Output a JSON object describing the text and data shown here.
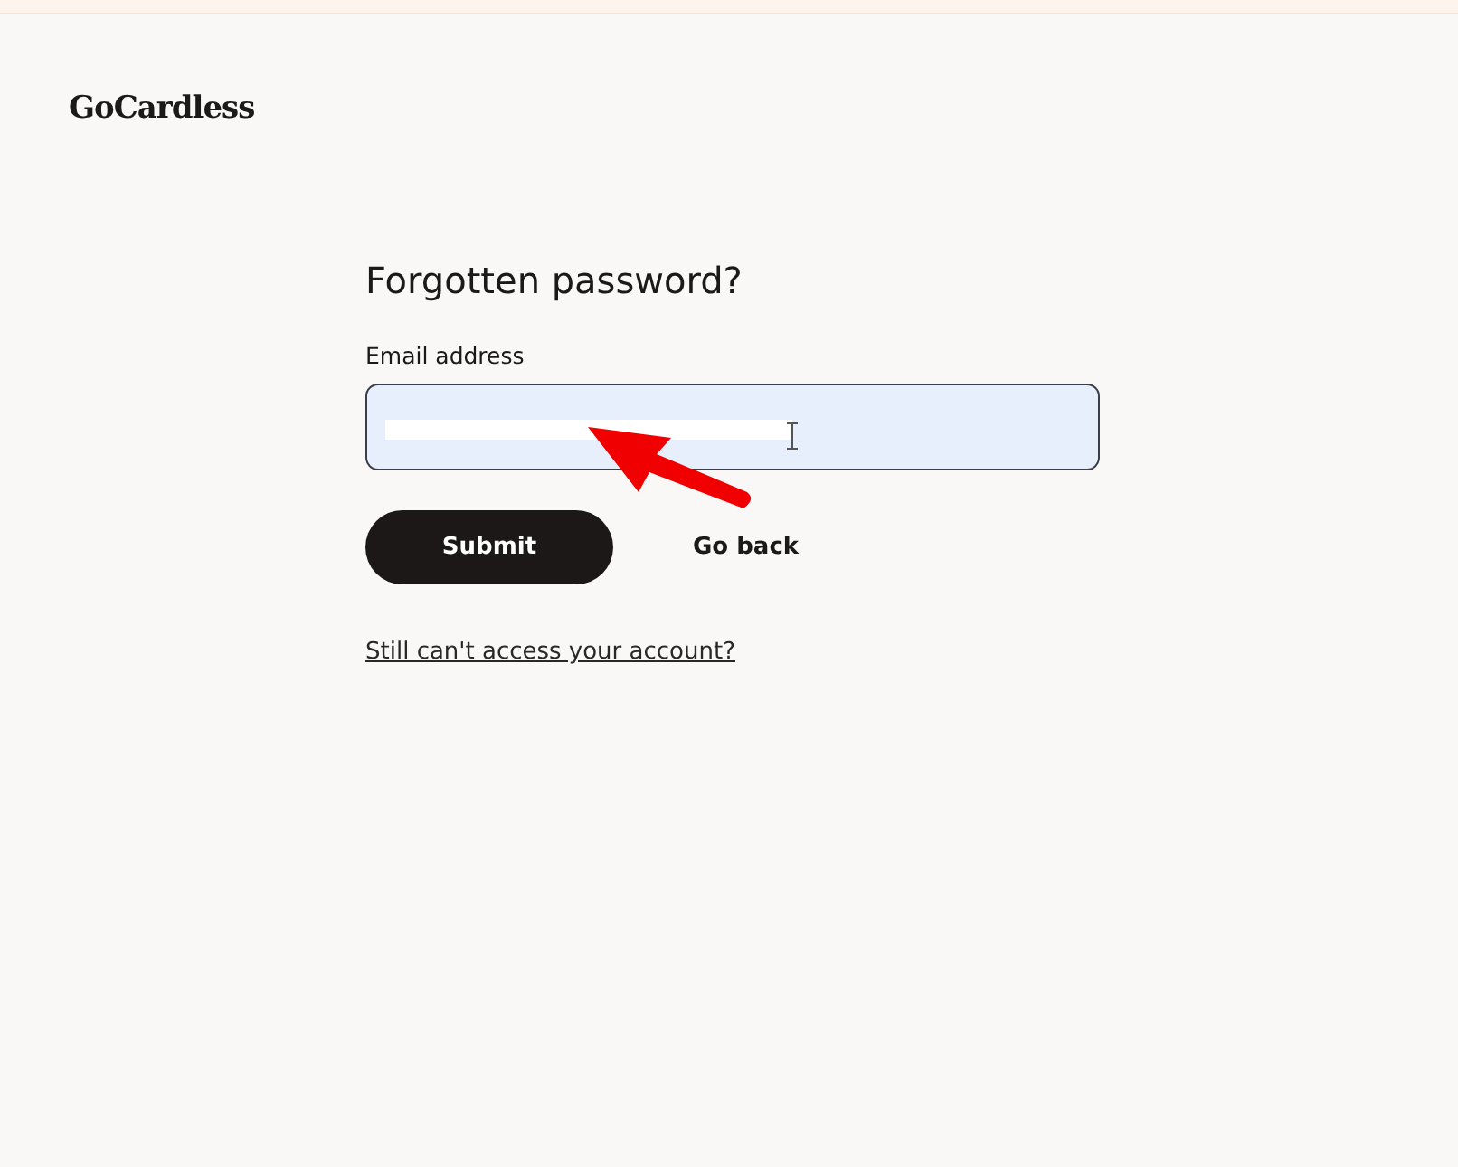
{
  "logo": {
    "text": "GoCardless"
  },
  "form": {
    "title": "Forgotten password?",
    "email": {
      "label": "Email address",
      "focused": true,
      "redacted": true
    },
    "submit": "Submit",
    "back": "Go back",
    "help_link": "Still can't access your account?"
  },
  "annotation": {
    "kind": "arrow"
  }
}
